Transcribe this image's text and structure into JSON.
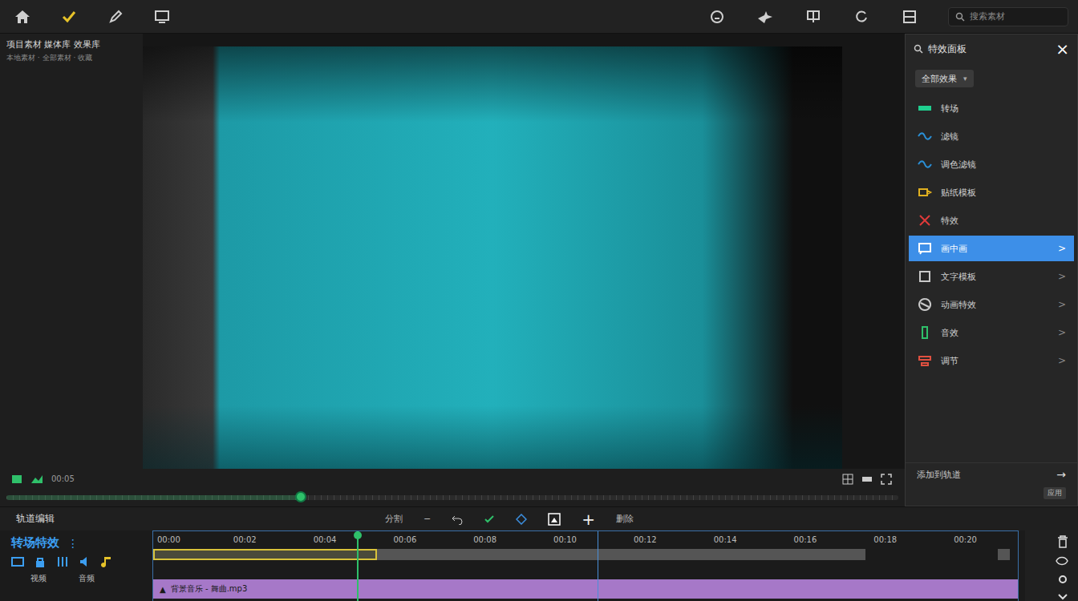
{
  "toolbar": {
    "search_placeholder": "搜索素材"
  },
  "media_panel": {
    "title": "项目素材 媒体库 效果库",
    "subtitle": "本地素材 · 全部素材 · 收藏"
  },
  "player": {
    "timecode": "00:05",
    "progress": 0.33
  },
  "effects_panel": {
    "title": "特效面板",
    "close": "×",
    "filter": "全部效果",
    "filter_caret": "▾",
    "items": [
      {
        "label": "转场",
        "selected": false,
        "color": "#1fcf8f",
        "arrow": ""
      },
      {
        "label": "滤镜",
        "selected": false,
        "color": "#2a8fd6",
        "arrow": ""
      },
      {
        "label": "调色滤镜",
        "selected": false,
        "color": "#2a8fd6",
        "arrow": ""
      },
      {
        "label": "贴纸模板",
        "selected": false,
        "color": "#e0b020",
        "arrow": ""
      },
      {
        "label": "特效",
        "selected": false,
        "color": "#e03a3a",
        "arrow": ""
      },
      {
        "label": "画中画",
        "selected": true,
        "color": "#ffffff",
        "arrow": ">"
      },
      {
        "label": "文字模板",
        "selected": false,
        "color": "#c8c8c8",
        "arrow": ">"
      },
      {
        "label": "动画特效",
        "selected": false,
        "color": "#c8c8c8",
        "arrow": ">"
      },
      {
        "label": "音效",
        "selected": false,
        "color": "#2fc06a",
        "arrow": ">"
      },
      {
        "label": "调节",
        "selected": false,
        "color": "#e05040",
        "arrow": ">"
      }
    ],
    "footer": {
      "label": "添加到轨道",
      "action": "→",
      "badge": "应用"
    }
  },
  "timeline_toolbar": {
    "label": "轨道编辑",
    "split": "分割",
    "minus": "−",
    "add": "+",
    "delete": "删除"
  },
  "timeline": {
    "title": "转场特效",
    "menu": "⋮",
    "track_labels": [
      "视频",
      "音频"
    ],
    "range_end": 21.6,
    "playhead": 5.1,
    "marker": 11.1,
    "ruler": [
      {
        "label": "00:00",
        "at": 0.1
      },
      {
        "label": "00:02",
        "at": 2
      },
      {
        "label": "00:04",
        "at": 4
      },
      {
        "label": "00:06",
        "at": 6
      },
      {
        "label": "00:08",
        "at": 8
      },
      {
        "label": "00:10",
        "at": 10
      },
      {
        "label": "00:12",
        "at": 12
      },
      {
        "label": "00:14",
        "at": 14
      },
      {
        "label": "00:16",
        "at": 16
      },
      {
        "label": "00:18",
        "at": 18
      },
      {
        "label": "00:20",
        "at": 20
      }
    ],
    "clips": [
      {
        "selected": true,
        "start": 0,
        "end": 5.6
      },
      {
        "selected": false,
        "start": 5.6,
        "end": 17.8
      },
      {
        "selected": false,
        "start": 21.1,
        "end": 21.4
      }
    ],
    "audio": {
      "icon": "▲",
      "label": "背景音乐 - 舞曲.mp3",
      "start": 0,
      "end": 21.6
    }
  }
}
